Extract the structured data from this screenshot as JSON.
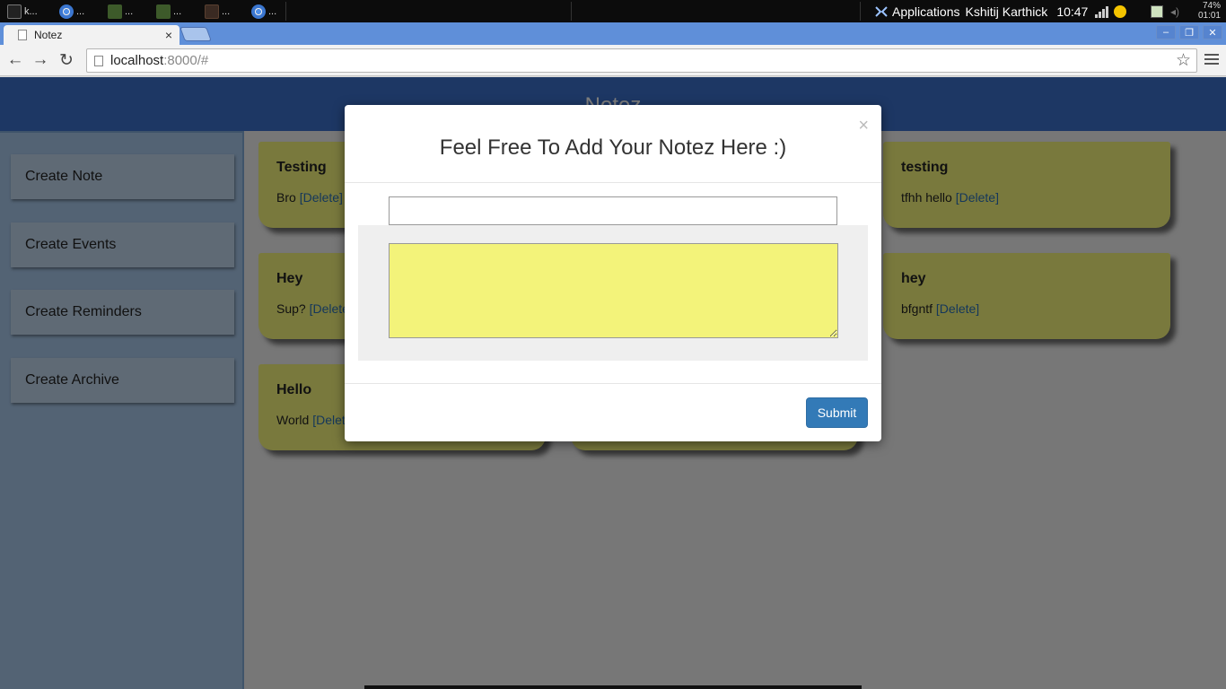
{
  "taskbar": {
    "tasks": [
      "k...",
      "...",
      "...",
      "...",
      "...",
      "..."
    ],
    "apps_label": "Applications",
    "user": "Kshitij Karthick",
    "clock": "10:47",
    "battery_percent": "74%",
    "battery_time": "01:01"
  },
  "browser": {
    "tab_title": "Notez",
    "url_host": "localhost",
    "url_rest": ":8000/#"
  },
  "page": {
    "title": "Notez",
    "sidebar": [
      {
        "label": "Create Note"
      },
      {
        "label": "Create Events"
      },
      {
        "label": "Create Reminders"
      },
      {
        "label": "Create Archive"
      }
    ],
    "notes": [
      {
        "title": "Testing",
        "body": "Bro",
        "delete_label": "[Delete]"
      },
      {
        "title": "Hey",
        "body": "Sup?",
        "delete_label": "[Delete]"
      },
      {
        "title": "Hello",
        "body": "World",
        "delete_label": "[Delete]"
      },
      {
        "title": "testing",
        "body": "tfhh hello",
        "delete_label": "[Delete]"
      },
      {
        "title": "hey",
        "body": "bfgntf",
        "delete_label": "[Delete]"
      }
    ]
  },
  "modal": {
    "close_label": "×",
    "title": "Feel Free To Add Your Notez Here :)",
    "title_input_value": "",
    "body_input_value": "",
    "submit_label": "Submit"
  },
  "colors": {
    "header_blue": "#3b6fc8",
    "note_yellow": "#f3f37a",
    "submit_blue": "#337ab7",
    "delete_link": "#2a6fb5"
  }
}
